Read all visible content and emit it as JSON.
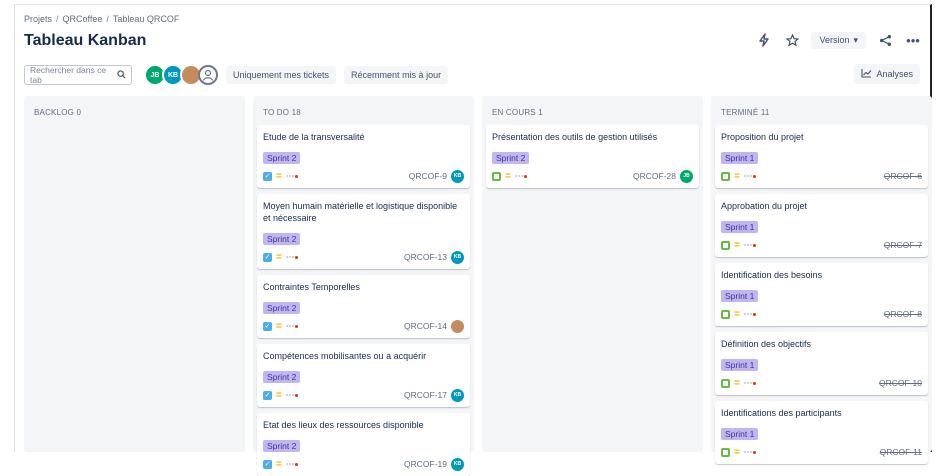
{
  "breadcrumb": [
    "Projets",
    "QRCoffee",
    "Tableau QRCOF"
  ],
  "page_title": "Tableau Kanban",
  "top_actions": {
    "version_label": "Version"
  },
  "toolbar": {
    "search_placeholder": "Rechercher dans ce tab",
    "avatars": [
      "JB",
      "KB"
    ],
    "filter_mine": "Uniquement mes tickets",
    "filter_recent": "Récemment mis à jour",
    "analyses": "Analyses"
  },
  "colors": {
    "sprint_bg": "#c0b6f2",
    "task_blue": "#4bade8",
    "story_green": "#65ba43",
    "priority_yellow": "#ffab00"
  },
  "columns": [
    {
      "header": "BACKLOG 0",
      "cards": []
    },
    {
      "header": "TO DO 18",
      "cards": [
        {
          "title": "Etude de la transversalité",
          "sprint": "Sprint 2",
          "key": "QRCOF-9",
          "type": "task",
          "avatar": "KB",
          "avatar_style": "teal",
          "done": false
        },
        {
          "title": "Moyen humain matérielle et logistique disponible et nécessaire",
          "sprint": "Sprint 2",
          "key": "QRCOF-13",
          "type": "task",
          "avatar": "KB",
          "avatar_style": "teal",
          "done": false
        },
        {
          "title": "Contraintes Temporelles",
          "sprint": "Sprint 2",
          "key": "QRCOF-14",
          "type": "task",
          "avatar": "",
          "avatar_style": "photo",
          "done": false
        },
        {
          "title": "Compétences mobilisantes ou a acquérir",
          "sprint": "Sprint 2",
          "key": "QRCOF-17",
          "type": "task",
          "avatar": "KB",
          "avatar_style": "teal",
          "done": false
        },
        {
          "title": "Etat des lieux des ressources disponible",
          "sprint": "Sprint 2",
          "key": "QRCOF-19",
          "type": "task",
          "avatar": "KB",
          "avatar_style": "teal",
          "done": false
        }
      ]
    },
    {
      "header": "EN COURS 1",
      "cards": [
        {
          "title": "Présentation des outils de gestion utilisés",
          "sprint": "Sprint 2",
          "key": "QRCOF-28",
          "type": "story",
          "avatar": "JB",
          "avatar_style": "green",
          "done": false
        }
      ]
    },
    {
      "header": "TERMINÉ 11",
      "cards": [
        {
          "title": "Proposition du projet",
          "sprint": "Sprint 1",
          "key": "QRCOF-6",
          "type": "story",
          "avatar": "",
          "avatar_style": "",
          "done": true
        },
        {
          "title": "Approbation du projet",
          "sprint": "Sprint 1",
          "key": "QRCOF-7",
          "type": "story",
          "avatar": "",
          "avatar_style": "",
          "done": true
        },
        {
          "title": "Identification des besoins",
          "sprint": "Sprint 1",
          "key": "QRCOF-8",
          "type": "story",
          "avatar": "",
          "avatar_style": "",
          "done": true
        },
        {
          "title": "Définition des objectifs",
          "sprint": "Sprint 1",
          "key": "QRCOF-10",
          "type": "story",
          "avatar": "",
          "avatar_style": "",
          "done": true
        },
        {
          "title": "Identifications des participants",
          "sprint": "Sprint 1",
          "key": "QRCOF-11",
          "type": "story",
          "avatar": "",
          "avatar_style": "",
          "done": true
        }
      ]
    }
  ]
}
